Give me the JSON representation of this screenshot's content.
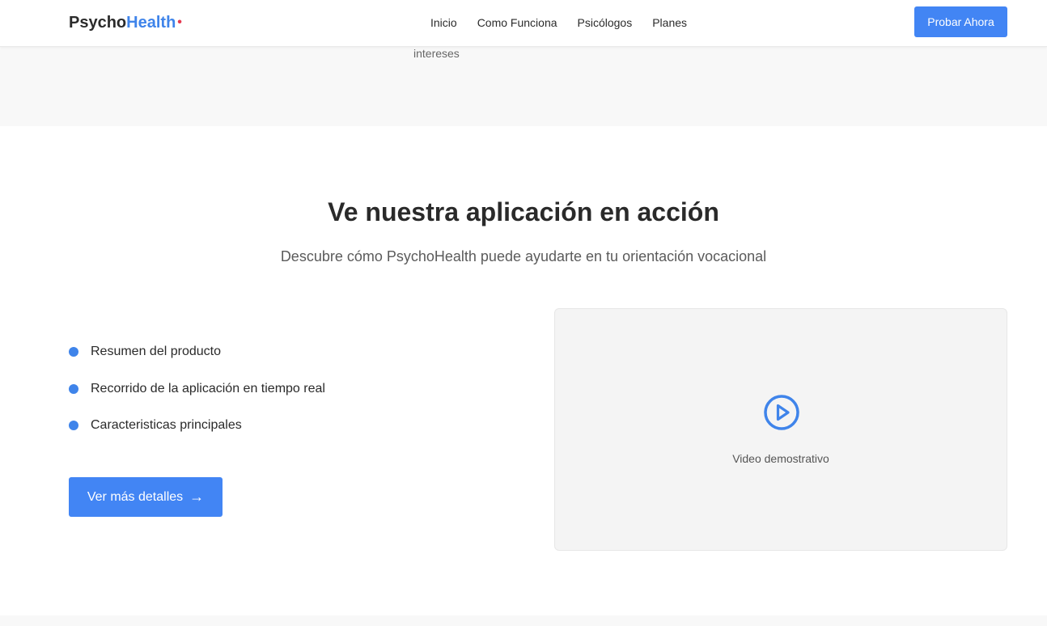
{
  "header": {
    "logo_part1": "Psycho",
    "logo_part2": "Health",
    "logo_dot": "•",
    "nav": [
      "Inicio",
      "Como Funciona",
      "Psicólogos",
      "Planes"
    ],
    "cta": "Probar Ahora"
  },
  "prev_section": {
    "text": "intereses"
  },
  "demo": {
    "title": "Ve nuestra aplicación en acción",
    "subtitle": "Descubre cómo PsychoHealth puede ayudarte en tu orientación vocacional",
    "features": [
      "Resumen del producto",
      "Recorrido de la aplicación en tiempo real",
      "Caracteristicas principales"
    ],
    "details_button": "Ver más detalles",
    "details_arrow": "→",
    "video_label": "Video demostrativo"
  },
  "colors": {
    "accent": "#4285f4",
    "brand_blue": "#3f84ea",
    "brand_red": "#e53950",
    "section_gray": "#f8f8f8"
  },
  "icons": {
    "play": "play-circle-icon",
    "bullet": "bullet-dot-icon",
    "arrow": "arrow-right-icon"
  }
}
